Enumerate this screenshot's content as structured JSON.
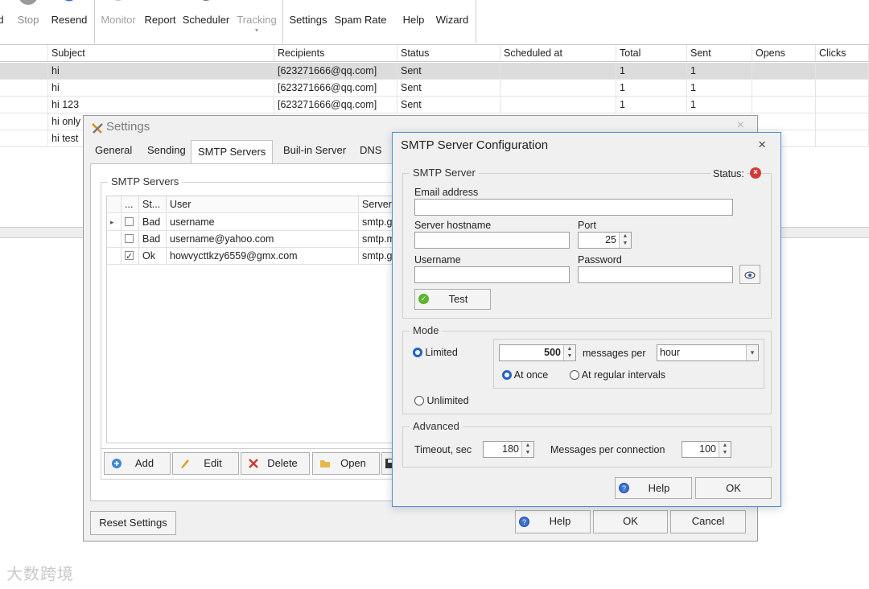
{
  "toolbar": {
    "buttons": [
      {
        "label": "Stop"
      },
      {
        "label": "Resend"
      },
      {
        "label": "Monitor"
      },
      {
        "label": "Report"
      },
      {
        "label": "Scheduler"
      },
      {
        "label": "Tracking"
      },
      {
        "label": "Settings"
      },
      {
        "label": "Spam Rate"
      },
      {
        "label": "Help"
      },
      {
        "label": "Wizard"
      }
    ],
    "partial_label": "d",
    "tracking_arrow": "▾"
  },
  "grid": {
    "columns": [
      "Subject",
      "Recipients",
      "Status",
      "Scheduled at",
      "Total",
      "Sent",
      "Opens",
      "Clicks"
    ],
    "rows": [
      {
        "subject": "hi",
        "recipients": "[623271666@qq.com]",
        "status": "Sent",
        "scheduled": "",
        "total": "1",
        "sent": "1"
      },
      {
        "subject": "hi",
        "recipients": "[623271666@qq.com]",
        "status": "Sent",
        "scheduled": "",
        "total": "1",
        "sent": "1"
      },
      {
        "subject": "hi 123",
        "recipients": "[623271666@qq.com]",
        "status": "Sent",
        "scheduled": "",
        "total": "1",
        "sent": "1"
      },
      {
        "subject": "hi only",
        "recipients": "",
        "status": "",
        "scheduled": "",
        "total": "",
        "sent": ""
      },
      {
        "subject": "hi test",
        "recipients": "",
        "status": "",
        "scheduled": "",
        "total": "",
        "sent": ""
      }
    ]
  },
  "settings": {
    "title": "Settings",
    "close": "×",
    "tabs": [
      "General",
      "Sending",
      "SMTP Servers",
      "Buil-in Server",
      "DNS"
    ],
    "smtp_group_title": "SMTP Servers",
    "smtp_columns": [
      "...",
      "St...",
      "User",
      "Server"
    ],
    "smtp_rows": [
      {
        "checked": false,
        "status": "Bad",
        "user": "username",
        "server": "smtp.gr"
      },
      {
        "checked": false,
        "status": "Bad",
        "user": "username@yahoo.com",
        "server": "smtp.m"
      },
      {
        "checked": true,
        "status": "Ok",
        "user": "howvycttkzy6559@gmx.com",
        "server": "smtp.gr"
      }
    ],
    "row_arrow": "▸",
    "buttons": {
      "add": "Add",
      "edit": "Edit",
      "delete": "Delete",
      "open": "Open"
    },
    "reset_label": "Reset Settings",
    "help_label": "Help",
    "ok_label": "OK",
    "cancel_label": "Cancel"
  },
  "dialog": {
    "title": "SMTP Server Configuration",
    "close": "×",
    "server_group": "SMTP Server",
    "status_label": "Status:",
    "email_label": "Email address",
    "email_value": "",
    "hostname_label": "Server hostname",
    "hostname_value": "",
    "port_label": "Port",
    "port_value": "25",
    "username_label": "Username",
    "username_value": "",
    "password_label": "Password",
    "password_value": "",
    "test_label": "Test",
    "mode_group": "Mode",
    "limited_label": "Limited",
    "limited_selected": true,
    "messages_value": "500",
    "messages_per_label": "messages per",
    "period_value": "hour",
    "dropdown_arrow": "▾",
    "at_once_label": "At once",
    "at_once_selected": true,
    "regular_label": "At regular intervals",
    "unlimited_label": "Unlimited",
    "advanced_group": "Advanced",
    "timeout_label": "Timeout, sec",
    "timeout_value": "180",
    "mpc_label": "Messages per connection",
    "mpc_value": "100",
    "help_label": "Help",
    "ok_label": "OK"
  },
  "watermark": "大数跨境"
}
